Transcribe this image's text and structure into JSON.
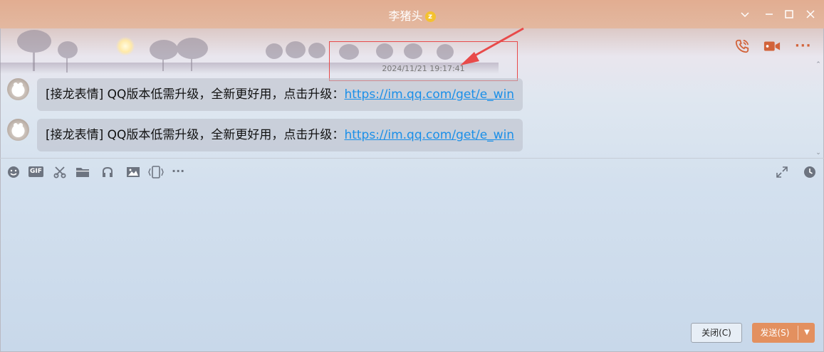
{
  "window": {
    "title": "李猪头",
    "title_badge": "z",
    "controls": [
      "chevron-down",
      "minimize",
      "maximize",
      "close"
    ]
  },
  "header_actions": {
    "voice_call": "phone-icon",
    "video_call": "video-icon",
    "more": "···"
  },
  "chat": {
    "timestamp": "2024/11/21 19:17:41",
    "messages": [
      {
        "text": "[接龙表情] QQ版本低需升级，全新更好用，点击升级：",
        "link": "https://im.qq.com/get/e_win"
      },
      {
        "text": "[接龙表情] QQ版本低需升级，全新更好用，点击升级：",
        "link": "https://im.qq.com/get/e_win"
      }
    ]
  },
  "toolbar": {
    "left": [
      "emoji-icon",
      "gif-icon",
      "scissors-icon",
      "folder-icon",
      "music-icon",
      "image-icon",
      "shake-icon",
      "more-icon"
    ],
    "gif_label": "GIF",
    "more_label": "···",
    "right": [
      "expand-icon",
      "history-clock-icon"
    ]
  },
  "footer": {
    "close_label": "关闭(C)",
    "send_label": "发送(S)",
    "send_dropdown": "▼"
  },
  "colors": {
    "accent": "#e3905f",
    "link": "#1a8fe8",
    "highlight": "#e84a4a",
    "call_icons": "#d2633a"
  }
}
